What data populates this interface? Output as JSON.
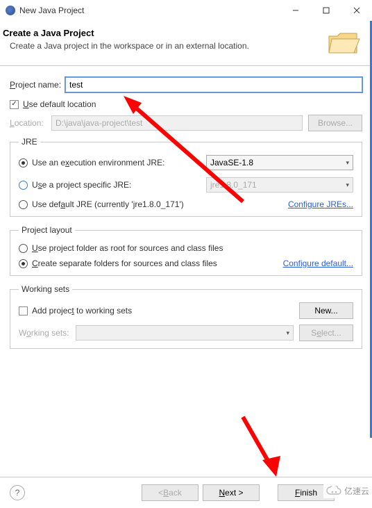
{
  "titlebar": {
    "title": "New Java Project"
  },
  "header": {
    "title": "Create a Java Project",
    "desc": "Create a Java project in the workspace or in an external location."
  },
  "projectName": {
    "label": "Project name:",
    "value": "test"
  },
  "useDefault": {
    "label": "Use default location"
  },
  "location": {
    "label": "Location:",
    "value": "D:\\java\\java-project\\test",
    "browse": "Browse..."
  },
  "jre": {
    "legend": "JRE",
    "execEnv": {
      "label": "Use an execution environment JRE:",
      "value": "JavaSE-1.8"
    },
    "projectSpecific": {
      "label": "Use a project specific JRE:",
      "value": "jre1.8.0_171"
    },
    "defaultJre": {
      "label": "Use default JRE (currently 'jre1.8.0_171')"
    },
    "configure": "Configure JREs..."
  },
  "layout": {
    "legend": "Project layout",
    "root": "Use project folder as root for sources and class files",
    "separate": "Create separate folders for sources and class files",
    "configure": "Configure default..."
  },
  "workingSets": {
    "legend": "Working sets",
    "add": "Add project to working sets",
    "new": "New...",
    "label": "Working sets:",
    "select": "Select..."
  },
  "footer": {
    "back": "< Back",
    "next": "Next >",
    "finish": "Finish"
  },
  "watermark": "亿速云"
}
